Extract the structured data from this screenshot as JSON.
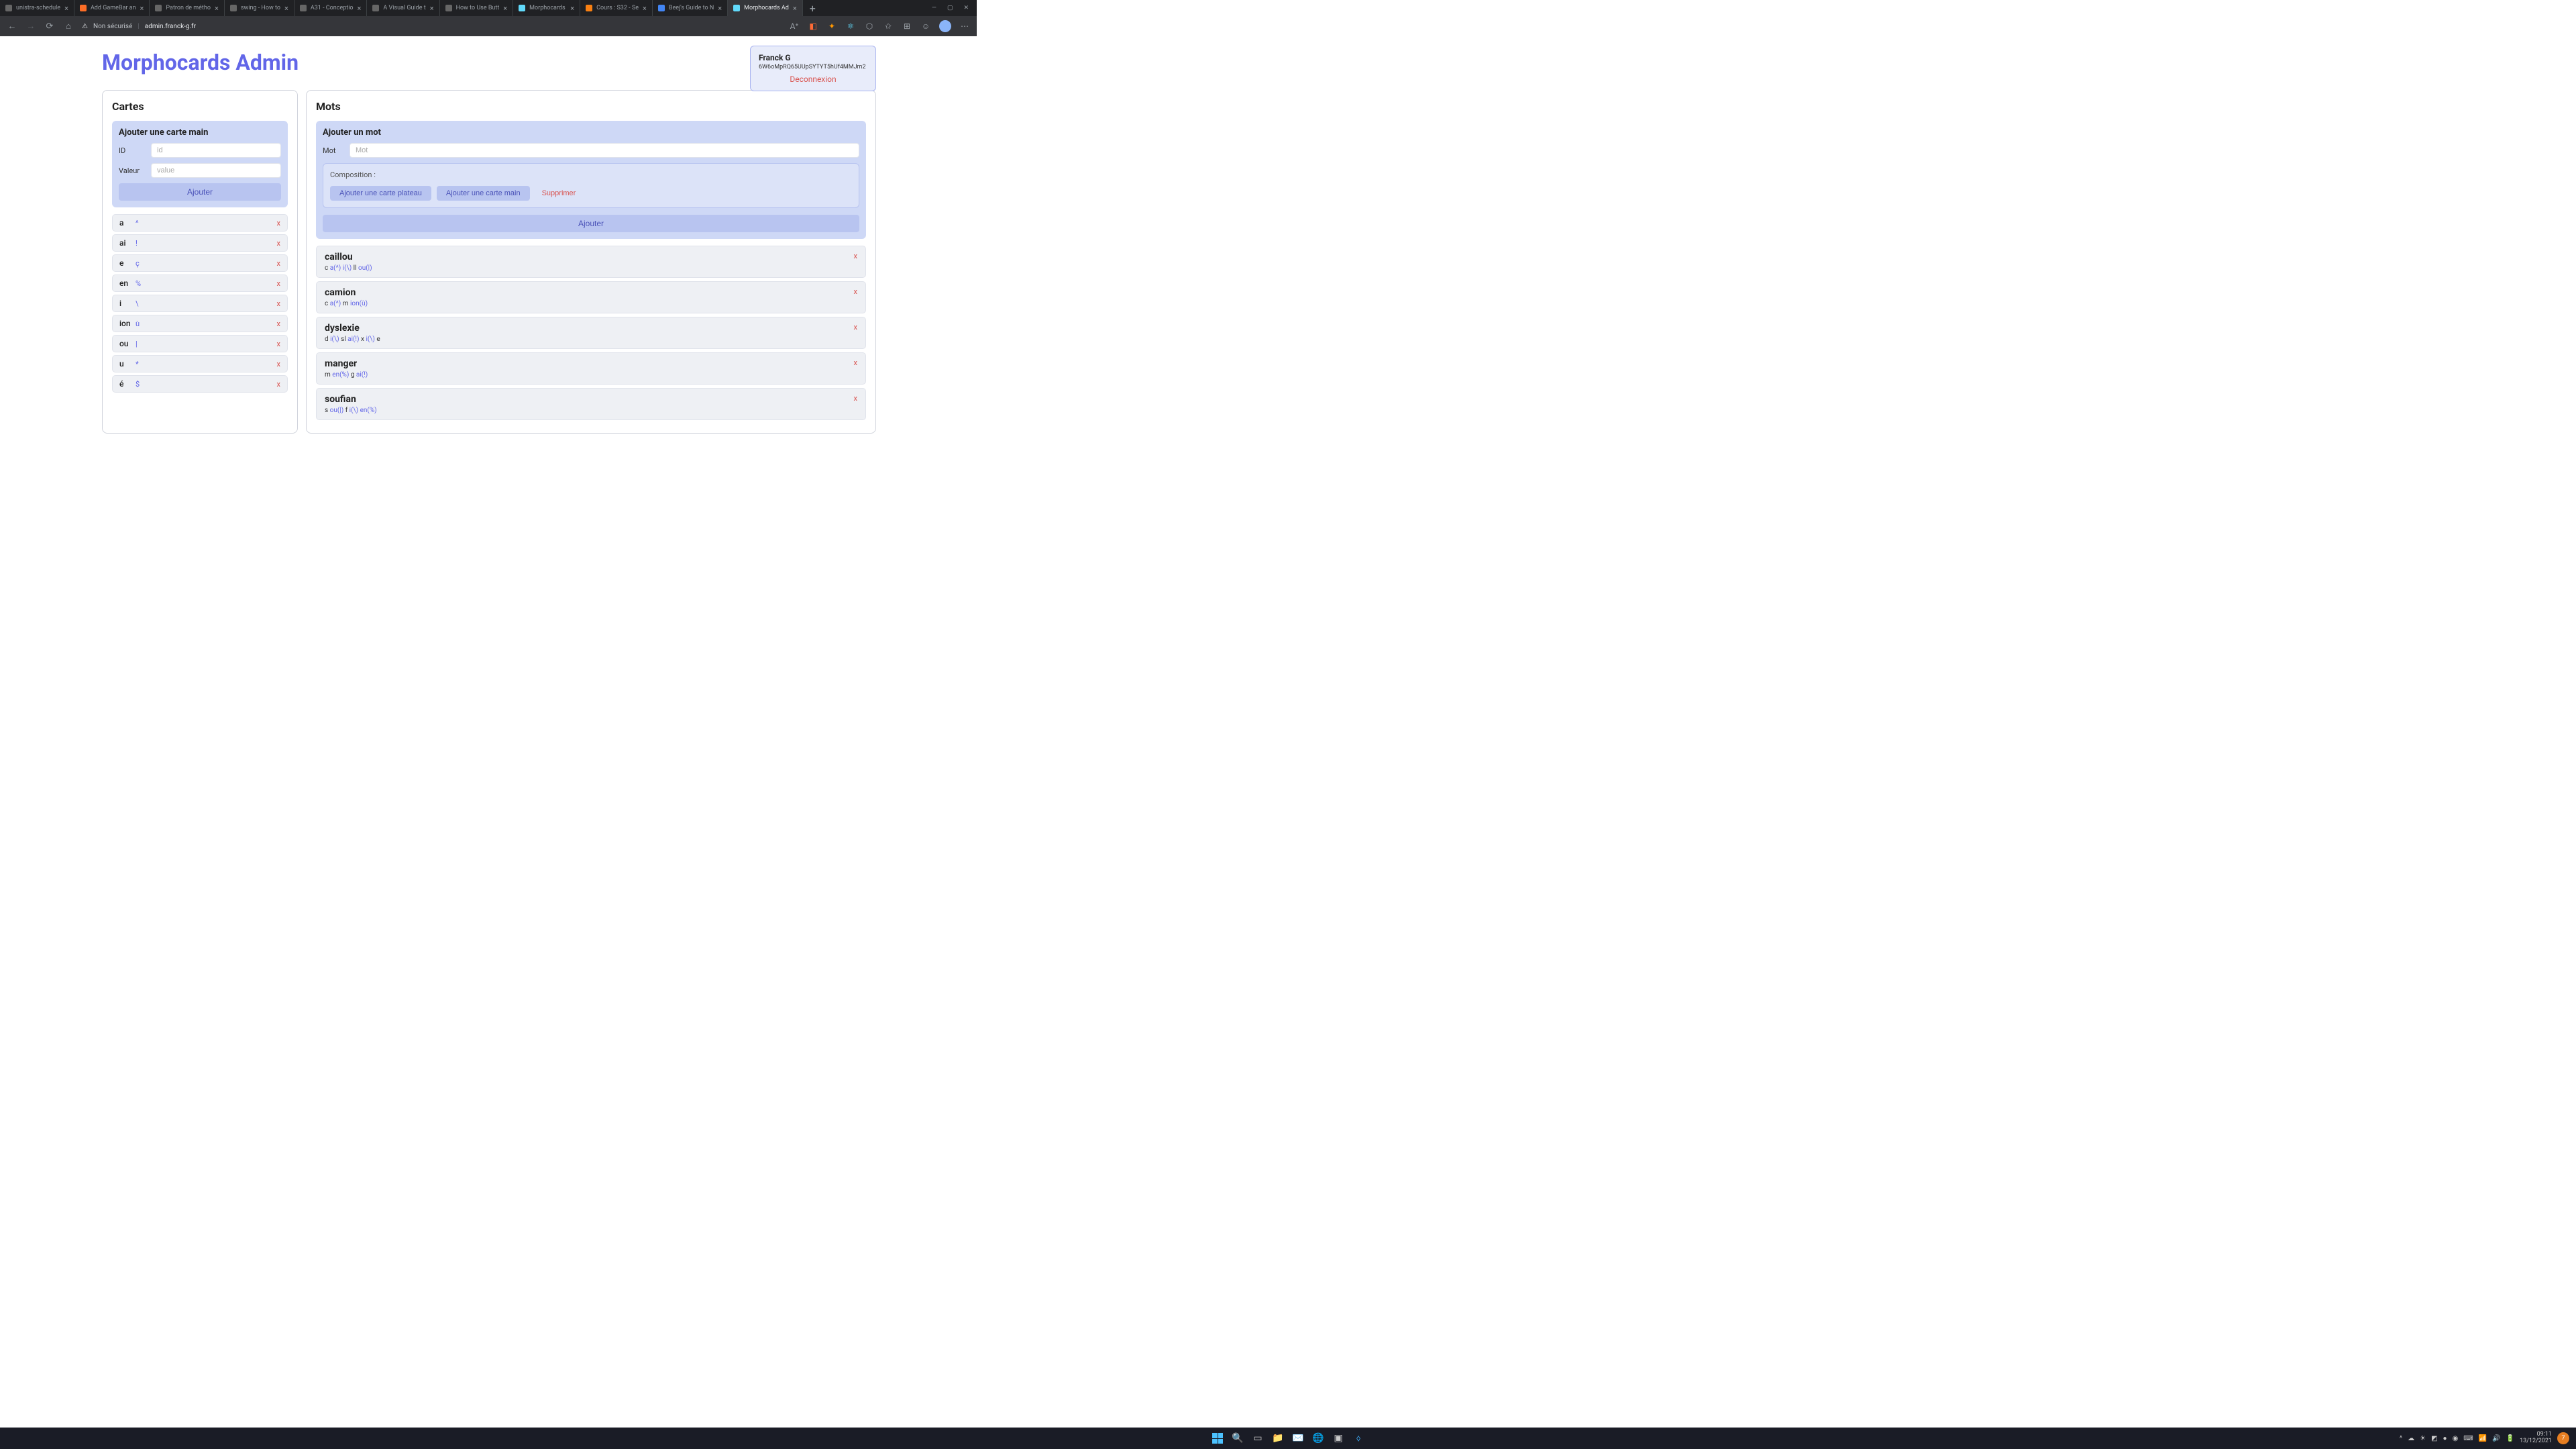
{
  "browser": {
    "tabs": [
      {
        "title": "unistra-schedule"
      },
      {
        "title": "Add GameBar an"
      },
      {
        "title": "Patron de métho"
      },
      {
        "title": "swing - How to"
      },
      {
        "title": "A31 - Conceptio"
      },
      {
        "title": "A Visual Guide t"
      },
      {
        "title": "How to Use Butt"
      },
      {
        "title": "Morphocards"
      },
      {
        "title": "Cours : S32 - Se"
      },
      {
        "title": "Beej's Guide to N"
      },
      {
        "title": "Morphocards Ad"
      }
    ],
    "active_tab_index": 10,
    "not_secure_label": "Non sécurisé",
    "url": "admin.franck-g.fr"
  },
  "page": {
    "title": "Morphocards Admin",
    "user": {
      "name": "Franck G",
      "token": "6W6oMpRQ65UUpSYTYT5hUf4MMJm2",
      "logout_label": "Deconnexion"
    },
    "cartes": {
      "heading": "Cartes",
      "form_title": "Ajouter une carte main",
      "id_label": "ID",
      "id_placeholder": "id",
      "valeur_label": "Valeur",
      "valeur_placeholder": "value",
      "ajouter_label": "Ajouter",
      "items": [
        {
          "id": "a",
          "val": "^"
        },
        {
          "id": "ai",
          "val": "!"
        },
        {
          "id": "e",
          "val": "ç"
        },
        {
          "id": "en",
          "val": "%"
        },
        {
          "id": "i",
          "val": "\\"
        },
        {
          "id": "ion",
          "val": "ù"
        },
        {
          "id": "ou",
          "val": "|"
        },
        {
          "id": "u",
          "val": "*"
        },
        {
          "id": "é",
          "val": "$"
        }
      ],
      "delete_label": "x"
    },
    "mots": {
      "heading": "Mots",
      "form_title": "Ajouter un mot",
      "mot_label": "Mot",
      "mot_placeholder": "Mot",
      "composition_label": "Composition :",
      "btn_plateau": "Ajouter une carte plateau",
      "btn_main": "Ajouter une carte main",
      "btn_supprimer": "Supprimer",
      "ajouter_label": "Ajouter",
      "delete_label": "x",
      "items": [
        {
          "name": "caillou",
          "compo": [
            {
              "t": "l",
              "v": "c"
            },
            {
              "t": "c",
              "v": "a(^)"
            },
            {
              "t": "c",
              "v": "i(\\)"
            },
            {
              "t": "l",
              "v": "ll"
            },
            {
              "t": "c",
              "v": "ou(|)"
            }
          ]
        },
        {
          "name": "camion",
          "compo": [
            {
              "t": "l",
              "v": "c"
            },
            {
              "t": "c",
              "v": "a(^)"
            },
            {
              "t": "l",
              "v": "m"
            },
            {
              "t": "c",
              "v": "ion(ù)"
            }
          ]
        },
        {
          "name": "dyslexie",
          "compo": [
            {
              "t": "l",
              "v": "d"
            },
            {
              "t": "c",
              "v": "i(\\)"
            },
            {
              "t": "l",
              "v": "sl"
            },
            {
              "t": "c",
              "v": "ai(!)"
            },
            {
              "t": "l",
              "v": "x"
            },
            {
              "t": "c",
              "v": "i(\\)"
            },
            {
              "t": "l",
              "v": "e"
            }
          ]
        },
        {
          "name": "manger",
          "compo": [
            {
              "t": "l",
              "v": "m"
            },
            {
              "t": "c",
              "v": "en(%)"
            },
            {
              "t": "l",
              "v": "g"
            },
            {
              "t": "c",
              "v": "ai(!)"
            }
          ]
        },
        {
          "name": "soufian",
          "compo": [
            {
              "t": "l",
              "v": "s"
            },
            {
              "t": "c",
              "v": "ou(|)"
            },
            {
              "t": "l",
              "v": "f"
            },
            {
              "t": "c",
              "v": "i(\\)"
            },
            {
              "t": "c",
              "v": "en(%)"
            }
          ]
        }
      ]
    }
  },
  "taskbar": {
    "time": "09:11",
    "date": "13/12/2021",
    "notif": "7"
  }
}
